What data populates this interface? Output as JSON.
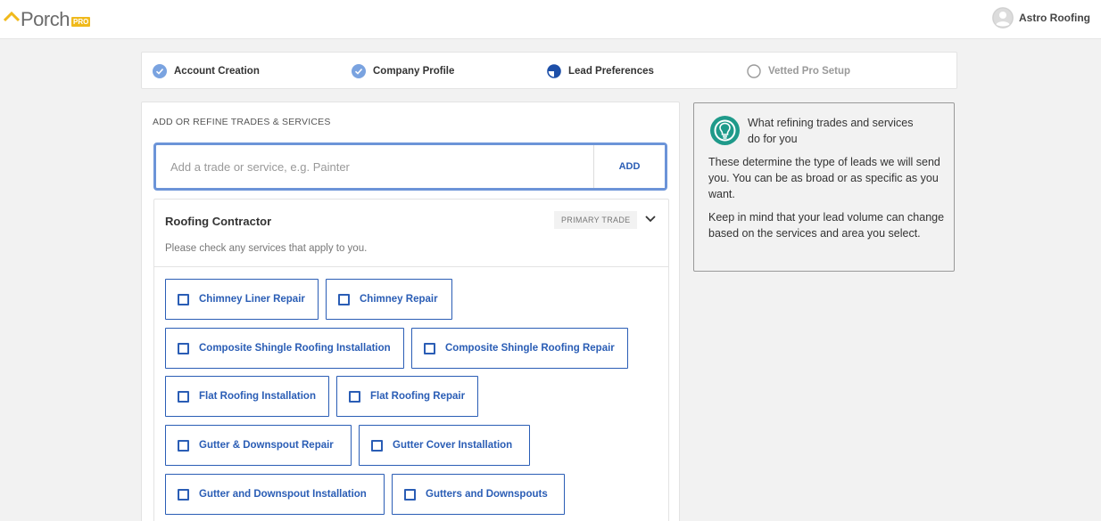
{
  "header": {
    "logo_text": "Porch",
    "logo_badge": "PRO",
    "user_name": "Astro Roofing"
  },
  "steps": [
    {
      "label": "Account Creation",
      "status": "complete"
    },
    {
      "label": "Company Profile",
      "status": "complete"
    },
    {
      "label": "Lead Preferences",
      "status": "in-progress"
    },
    {
      "label": "Vetted Pro Setup",
      "status": "not-started"
    }
  ],
  "trades": {
    "section_title": "ADD OR REFINE TRADES & SERVICES",
    "search_placeholder": "Add a trade or service, e.g. Painter",
    "search_value": "",
    "add_label": "ADD",
    "trade_name": "Roofing Contractor",
    "trade_badge": "PRIMARY TRADE",
    "hint": "Please check any services that apply to you.",
    "services": [
      {
        "label": "Chimney Liner Repair",
        "checked": false
      },
      {
        "label": "Chimney Repair",
        "checked": false
      },
      {
        "label": "Composite Shingle Roofing Installation",
        "checked": false
      },
      {
        "label": "Composite Shingle Roofing Repair",
        "checked": false
      },
      {
        "label": "Flat Roofing Installation",
        "checked": false
      },
      {
        "label": "Flat Roofing Repair",
        "checked": false
      },
      {
        "label": "Gutter & Downspout Repair",
        "checked": false
      },
      {
        "label": "Gutter Cover Installation",
        "checked": false
      },
      {
        "label": "Gutter and Downspout Installation",
        "checked": false
      },
      {
        "label": "Gutters and Downspouts",
        "checked": false
      }
    ]
  },
  "info": {
    "heading": "What refining trades and services do for you",
    "p1": "These determine the type of leads we will send you. You can be as broad or as specific as you want.",
    "p2": "Keep in mind that your lead volume can change based on the services and area you select."
  },
  "colors": {
    "accent": "#2a5db5",
    "step_check": "#7aa3e0",
    "logo_gold": "#f0b91b",
    "info_icon": "#1f9a8a"
  },
  "icons": {
    "logo": "porch-roof-icon",
    "avatar": "user-avatar-icon",
    "step_complete": "check-circle-icon",
    "step_in_progress": "half-circle-icon",
    "step_pending": "empty-circle-icon",
    "chevron": "chevron-down-icon",
    "info": "lightbulb-icon"
  }
}
